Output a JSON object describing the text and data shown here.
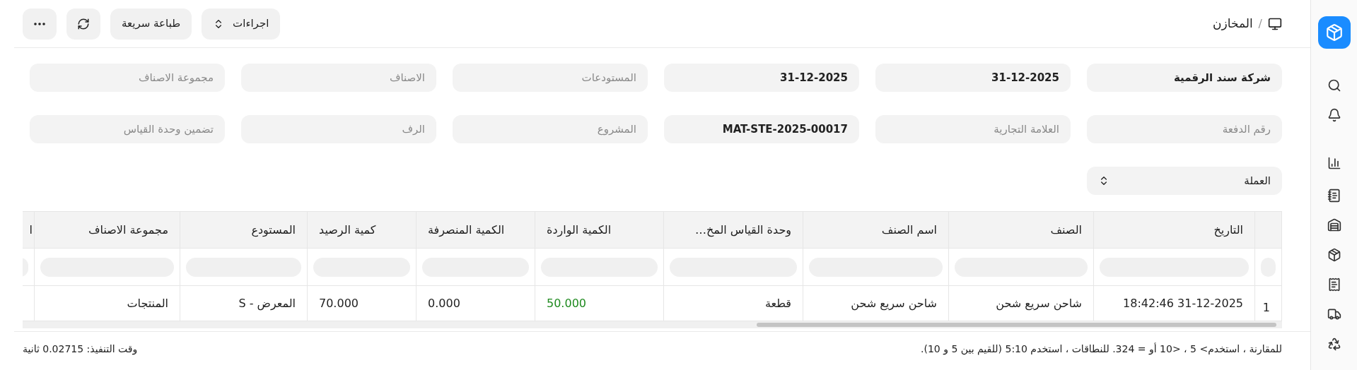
{
  "breadcrumb": {
    "separator": "/",
    "title": "المخازن"
  },
  "toolbar": [
    {
      "kind": "menu",
      "label": "اجراءات"
    },
    {
      "kind": "plain",
      "label": "طباعة سريعة"
    },
    {
      "kind": "refresh"
    },
    {
      "kind": "more"
    }
  ],
  "filters": [
    {
      "value": "شركة سند الرقمية"
    },
    {
      "value": "31-12-2025"
    },
    {
      "value": "31-12-2025"
    },
    {
      "placeholder": "المستودعات"
    },
    {
      "placeholder": "الاصناف"
    },
    {
      "placeholder": "مجموعة الاصناف"
    },
    {
      "placeholder": "رقم الدفعة"
    },
    {
      "placeholder": "العلامة التجارية"
    },
    {
      "value": "MAT-STE-2025-00017"
    },
    {
      "placeholder": "المشروع"
    },
    {
      "placeholder": "الرف"
    },
    {
      "placeholder": "تضمين وحدة القياس"
    }
  ],
  "currency_select": {
    "value": "العملة"
  },
  "table": {
    "columns": [
      {
        "kind": "index"
      },
      {
        "kind": "text",
        "label": "التاريخ"
      },
      {
        "kind": "text",
        "label": "الصنف"
      },
      {
        "kind": "text",
        "label": "اسم الصنف"
      },
      {
        "kind": "text",
        "label": "وحدة القياس المخ…"
      },
      {
        "kind": "number",
        "label": "الكمية الواردة"
      },
      {
        "kind": "number",
        "label": "الكمية المنصرفة"
      },
      {
        "kind": "number",
        "label": "كمية الرصيد"
      },
      {
        "kind": "text",
        "label": "المستودع"
      },
      {
        "kind": "text",
        "label": "مجموعة الاصناف"
      },
      {
        "kind": "text",
        "label": "ا"
      }
    ],
    "rows": [
      {
        "cells": [
          {
            "text": "1"
          },
          {
            "text": "31-12-2025 18:42:46"
          },
          {
            "text": "شاحن سريع شحن"
          },
          {
            "text": "شاحن سريع شحن"
          },
          {
            "text": "قطعة"
          },
          {
            "text": "50.000",
            "positive": true
          },
          {
            "text": "0.000"
          },
          {
            "text": "70.000"
          },
          {
            "text": "المعرض - S"
          },
          {
            "text": "المنتجات"
          },
          {
            "text": ""
          }
        ]
      }
    ]
  },
  "footer": {
    "hint": "للمقارنة ، استخدم> 5 ، <10 أو = 324. للنطاقات ، استخدم 5:10 (للقيم بين 5 و 10).",
    "execution_time": "وقت التنفيذ: 0.02715 ثانية"
  }
}
